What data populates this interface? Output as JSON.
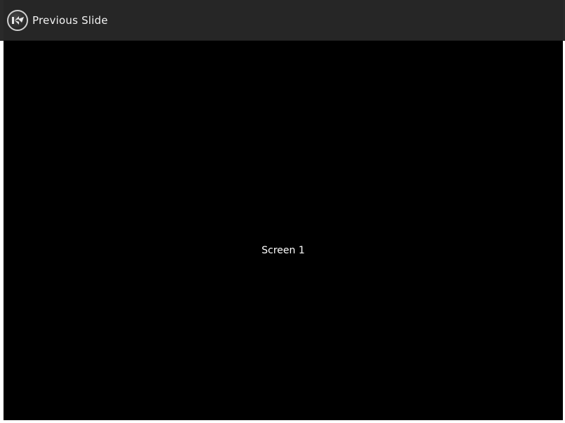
{
  "action_bar": {
    "previous_label": "Previous Slide",
    "icon": "kivy-logo-icon"
  },
  "screen": {
    "label": "Screen 1"
  },
  "colors": {
    "action_bar_bg": "#262626",
    "content_bg": "#000000",
    "text": "#ffffff"
  }
}
